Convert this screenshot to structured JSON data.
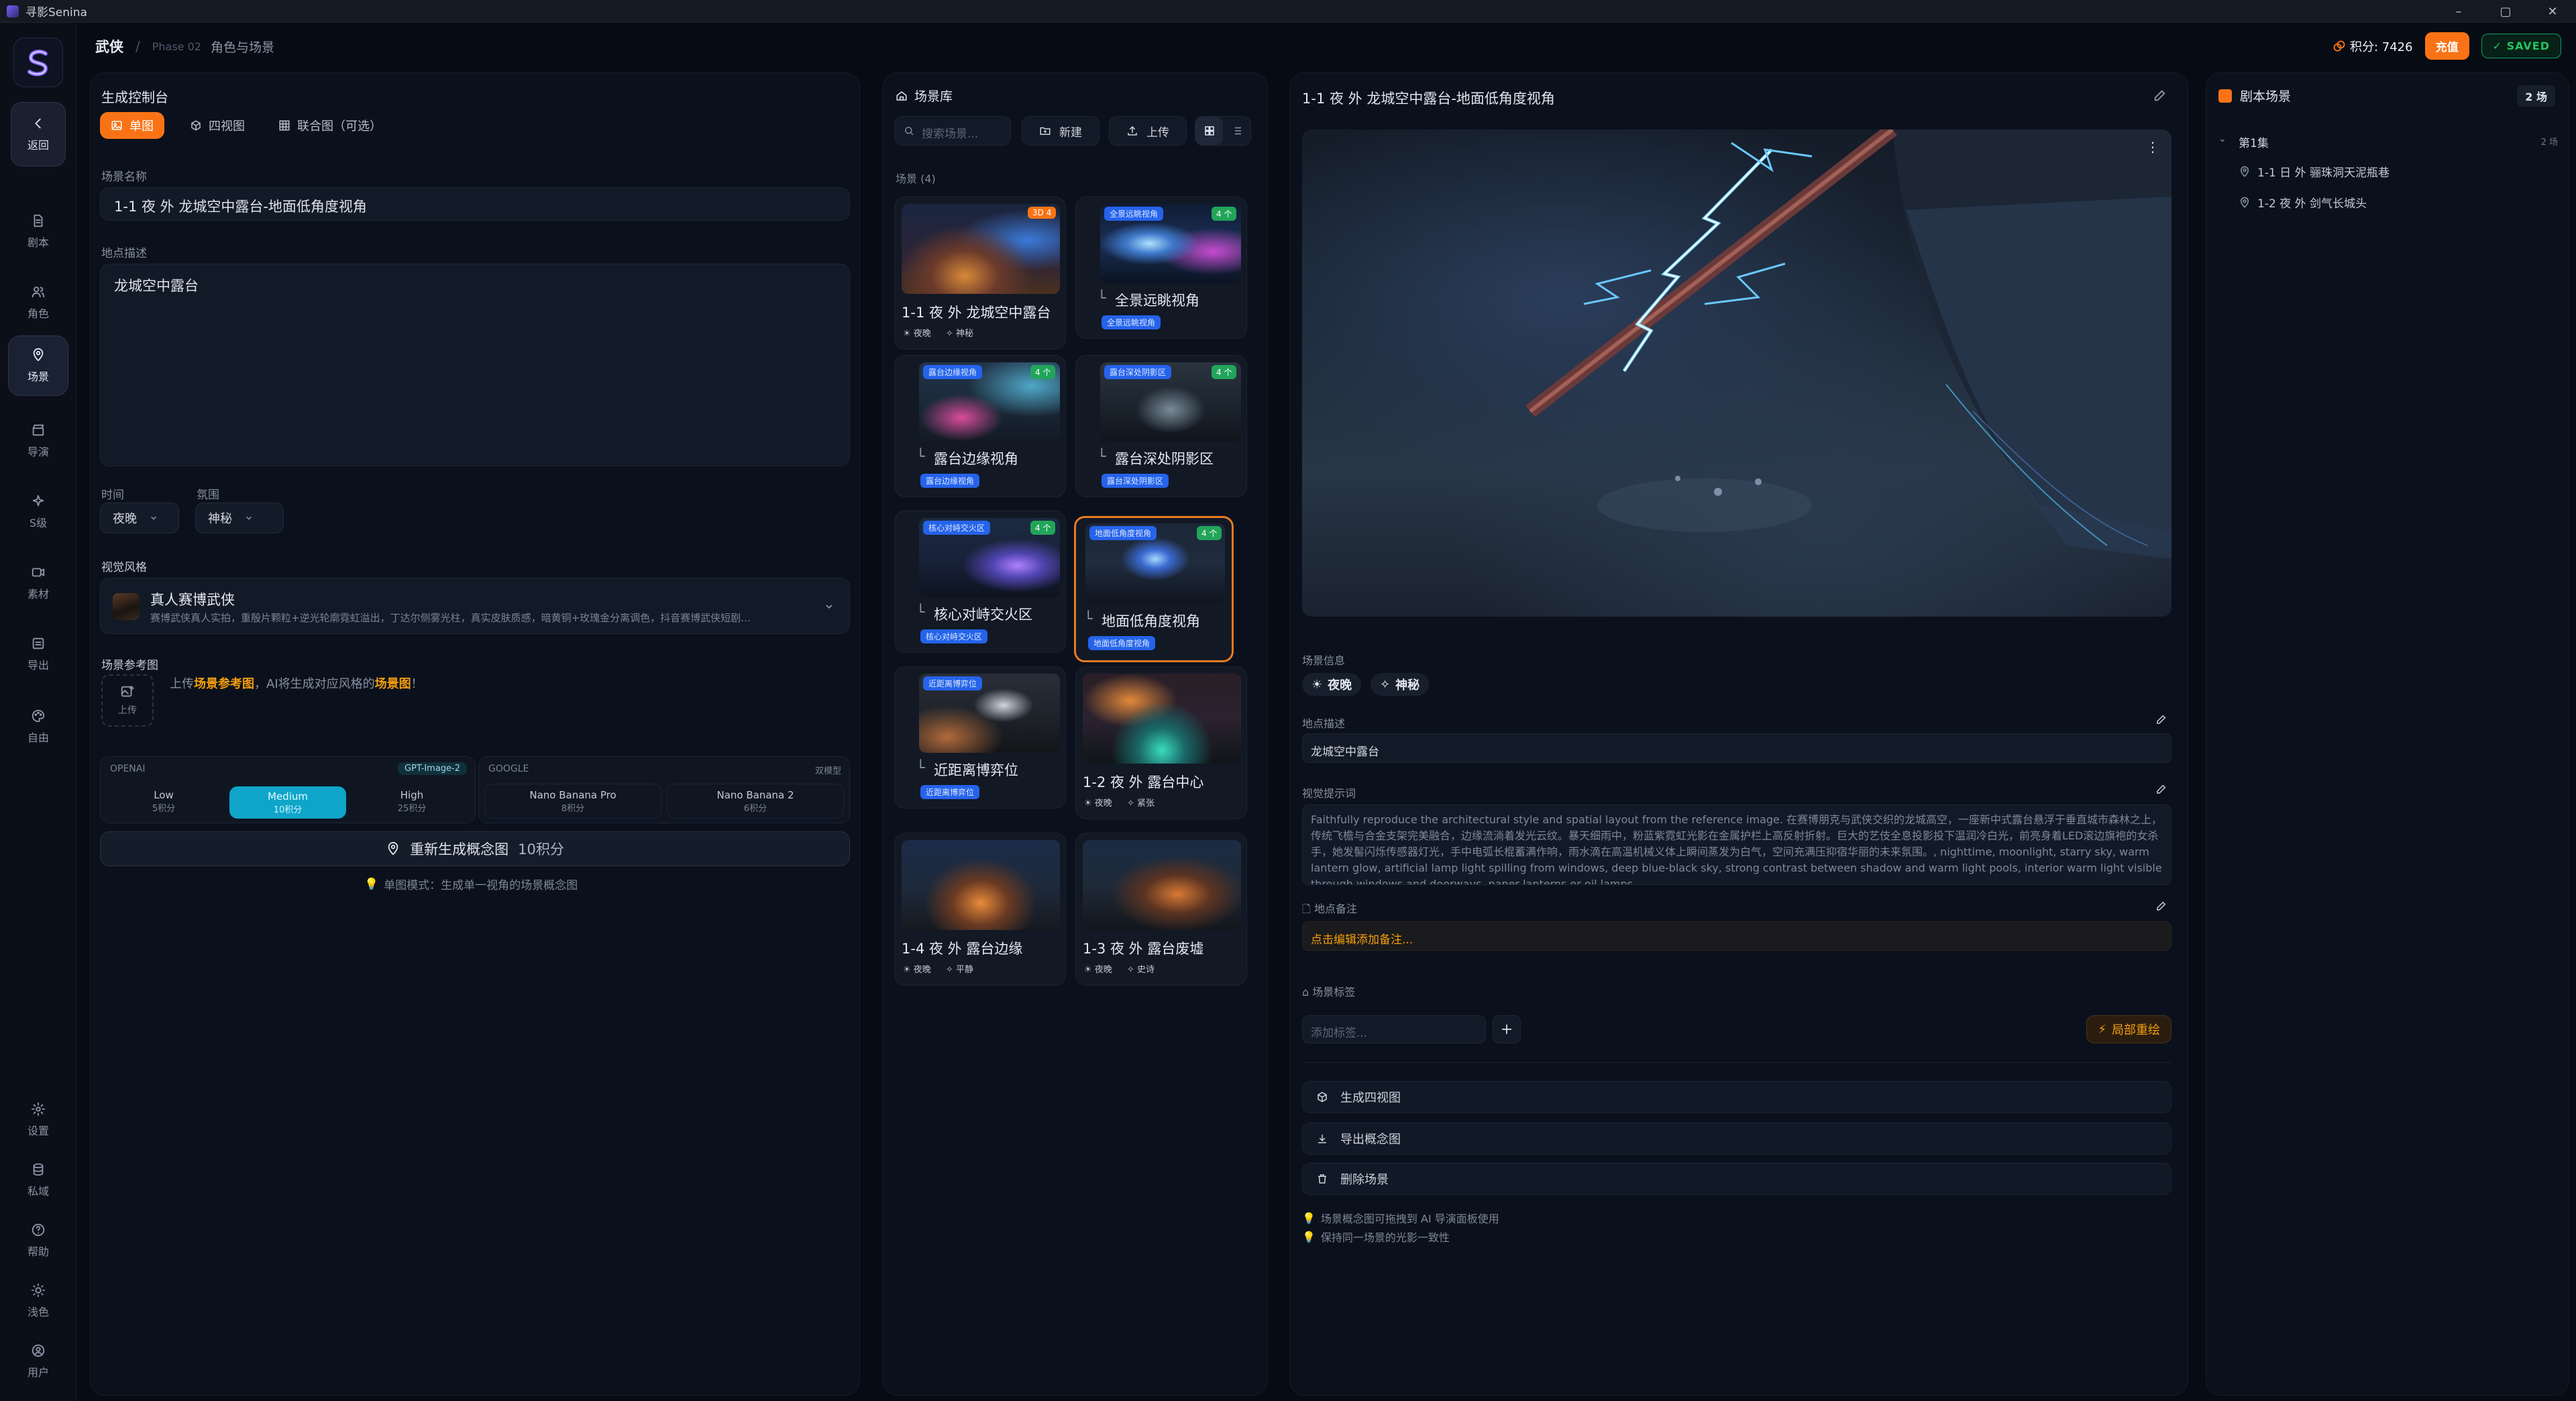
{
  "app": {
    "title": "寻影Senina"
  },
  "window_controls": {
    "minimize": "–",
    "maximize": "▢",
    "close": "✕"
  },
  "sidebar": {
    "back": "返回",
    "items": [
      {
        "label": "剧本",
        "icon": "document-icon"
      },
      {
        "label": "角色",
        "icon": "users-icon"
      },
      {
        "label": "场景",
        "icon": "location-icon",
        "active": true
      },
      {
        "label": "导演",
        "icon": "clapper-icon"
      },
      {
        "label": "S级",
        "icon": "sparkle-icon"
      },
      {
        "label": "素材",
        "icon": "video-icon"
      },
      {
        "label": "导出",
        "icon": "export-icon"
      },
      {
        "label": "自由",
        "icon": "palette-icon"
      }
    ],
    "bottom": [
      {
        "label": "设置",
        "icon": "gear-icon"
      },
      {
        "label": "私域",
        "icon": "database-icon"
      },
      {
        "label": "帮助",
        "icon": "help-icon"
      },
      {
        "label": "浅色",
        "icon": "sun-icon"
      },
      {
        "label": "用户",
        "icon": "user-icon"
      }
    ]
  },
  "topbar": {
    "breadcrumb": [
      "武侠",
      "Phase 02",
      "角色与场景"
    ],
    "points_label": "积分: 7426",
    "recharge": "充值",
    "saved": "SAVED"
  },
  "console": {
    "title": "生成控制台",
    "tabs": [
      "单图",
      "四视图",
      "联合图（可选）"
    ],
    "name_label": "场景名称",
    "name_value": "1-1 夜 外 龙城空中露台-地面低角度视角",
    "desc_label": "地点描述",
    "desc_value": "龙城空中露台",
    "time_label": "时间",
    "time_value": "夜晚",
    "mood_label": "氛围",
    "mood_value": "神秘",
    "style_label": "视觉风格",
    "style_name": "真人赛博武侠",
    "style_desc": "赛博武侠真人实拍，重殷片颗粒+逆光轮廓霓虹溢出，丁达尔侧雾光柱，真实皮肤质感，暗黄铜+玫瑰金分离调色，抖音赛博武侠短剧…",
    "ref_label": "场景参考图",
    "ref_upload": "上传",
    "ref_hint_pre": "上传",
    "ref_hint_hl1": "场景参考图",
    "ref_hint_mid": "，AI将生成对应风格的",
    "ref_hint_hl2": "场景图",
    "ref_hint_end": "！",
    "providers": {
      "openai": {
        "name": "OPENAI",
        "badge": "GPT-Image-2",
        "options": [
          {
            "name": "Low",
            "cost": "5积分"
          },
          {
            "name": "Medium",
            "cost": "10积分",
            "selected": true
          },
          {
            "name": "High",
            "cost": "25积分"
          }
        ]
      },
      "google": {
        "name": "GOOGLE",
        "badge": "双模型",
        "options": [
          {
            "name": "Nano Banana Pro",
            "cost": "8积分"
          },
          {
            "name": "Nano Banana 2",
            "cost": "6积分"
          }
        ]
      }
    },
    "regen_label": "重新生成概念图",
    "regen_cost": "10积分",
    "footer_tip": "单图模式：生成单一视角的场景概念图"
  },
  "library": {
    "title": "场景库",
    "search_placeholder": "搜索场景...",
    "new": "新建",
    "upload": "上传",
    "count_label": "场景 (4)",
    "cards": [
      {
        "title": "1-1 夜 外 龙城空中露台",
        "tags": [
          "夜晚",
          "神秘"
        ],
        "corner": "3D 4",
        "kind": "main"
      },
      {
        "title": "全景远眺视角",
        "badge": "全景远眺视角",
        "corner": "4 个",
        "kind": "sub"
      },
      {
        "title": "露台边缘视角",
        "badge": "露台边缘视角",
        "corner": "4 个",
        "kind": "sub"
      },
      {
        "title": "露台深处阴影区",
        "badge": "露台深处阴影区",
        "corner": "4 个",
        "kind": "sub"
      },
      {
        "title": "核心对峙交火区",
        "badge": "核心对峙交火区",
        "corner": "4 个",
        "kind": "sub"
      },
      {
        "title": "地面低角度视角",
        "badge": "地面低角度视角",
        "corner": "4 个",
        "kind": "sub",
        "selected": true
      },
      {
        "title": "近距离博弈位",
        "badge": "近距离博弈位",
        "corner": "",
        "kind": "sub"
      },
      {
        "title": "1-2 夜 外 露台中心",
        "tags": [
          "夜晚",
          "紧张"
        ],
        "kind": "main"
      },
      {
        "title": "1-4 夜 外 露台边缘",
        "tags": [
          "夜晚",
          "平静"
        ],
        "kind": "main"
      },
      {
        "title": "1-3 夜 外 露台废墟",
        "tags": [
          "夜晚",
          "史诗"
        ],
        "kind": "main"
      }
    ]
  },
  "detail": {
    "title": "1-1 夜 外 龙城空中露台-地面低角度视角",
    "info_label": "场景信息",
    "tags": [
      "夜晚",
      "神秘"
    ],
    "loc_label": "地点描述",
    "loc_value": "龙城空中露台",
    "prompt_label": "视觉提示词",
    "prompt_value": "Faithfully reproduce the architectural style and spatial layout from the reference image. 在赛博朋克与武侠交织的龙城高空，一座新中式露台悬浮于垂直城市森林之上，传统飞檐与合金支架完美融合，边缘流淌着发光云纹。暴天细雨中，粉蓝紫霓虹光影在金属护栏上高反射折射。巨大的艺伎全息投影投下温润冷白光，前亮身着LED滚边旗袍的女杀手，她发髻闪烁传感器灯光，手中电弧长棍蓄满作响，雨水滴在高温机械义体上瞬间蒸发为白气，空间充满压抑宿华丽的未来氛围。, nighttime, moonlight, starry sky, warm lantern glow, artificial lamp light spilling from windows, deep blue-black sky, strong contrast between shadow and warm light pools, interior warm light visible through windows and doorways, paper lanterns or oil lamps",
    "note_label": "地点备注",
    "note_placeholder": "点击编辑添加备注...",
    "tags_label": "场景标签",
    "tag_placeholder": "添加标签...",
    "local_redraw": "局部重绘",
    "actions": [
      "生成四视图",
      "导出概念图",
      "删除场景"
    ],
    "tips": [
      "场景概念图可拖拽到 AI 导演面板使用",
      "保持同一场景的光影一致性"
    ]
  },
  "script_scenes": {
    "title": "剧本场景",
    "count": "2 场",
    "episode": "第1集",
    "episode_count": "2 场",
    "items": [
      "1-1 日 外 骊珠洞天泥瓶巷",
      "1-2 夜 外 剑气长城头"
    ]
  }
}
